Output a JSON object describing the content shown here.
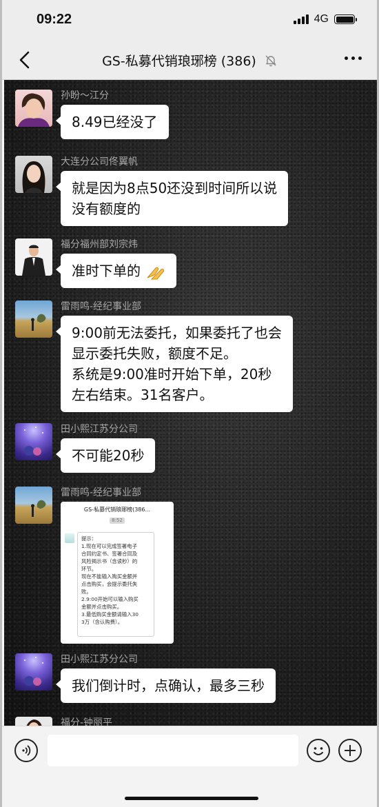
{
  "status": {
    "time": "09:22",
    "network": "4G"
  },
  "header": {
    "title": "GS-私募代销琅琊榜 (386)",
    "back_icon": "chevron-left-icon",
    "mute_icon": "bell-muted-icon",
    "more_icon": "more-dots-icon"
  },
  "messages": [
    {
      "sender": "孙盼～江分",
      "lines": [
        "8.49已经没了"
      ]
    },
    {
      "sender": "大连分公司佟翼帆",
      "lines": [
        "就是因为8点50还没到时间所以说",
        "没有额度的"
      ]
    },
    {
      "sender": "福分福州部刘宗炜",
      "lines": [
        "准时下单的"
      ],
      "emoji": "clapping-hands-emoji"
    },
    {
      "sender": "雷雨鸣-经纪事业部",
      "lines": [
        "9:00前无法委托，如果委托了也会",
        "显示委托失败，额度不足。",
        "系统是9:00准时开始下单，20秒",
        "左右结束。31名客户。"
      ]
    },
    {
      "sender": "田小熙江苏分公司",
      "lines": [
        "不可能20秒"
      ]
    },
    {
      "sender": "雷雨鸣-经纪事业部",
      "image": {
        "title": "GS-私募代销琅琊榜(386...",
        "time": "8:52",
        "lines": [
          "提示：",
          "1.现在可以完成签署电子",
          "合同约定书、签署合同及",
          "风险揭示书（含读秒）的",
          "环节。",
          "现在不能输入购买金额并",
          "点击购买，会提示委托失",
          "败。",
          "2.9:00开始可以输入购买",
          "金额并点击购买。",
          "3.最低购买金额请输入30",
          "3万（含认购费）。"
        ]
      }
    },
    {
      "sender": "田小熙江苏分公司",
      "lines": [
        "我们倒计时，点确认，最多三秒"
      ]
    },
    {
      "sender": "福分-钟丽平"
    }
  ],
  "input": {
    "voice_icon": "voice-icon",
    "emoji_icon": "smiley-icon",
    "plus_icon": "plus-icon"
  }
}
